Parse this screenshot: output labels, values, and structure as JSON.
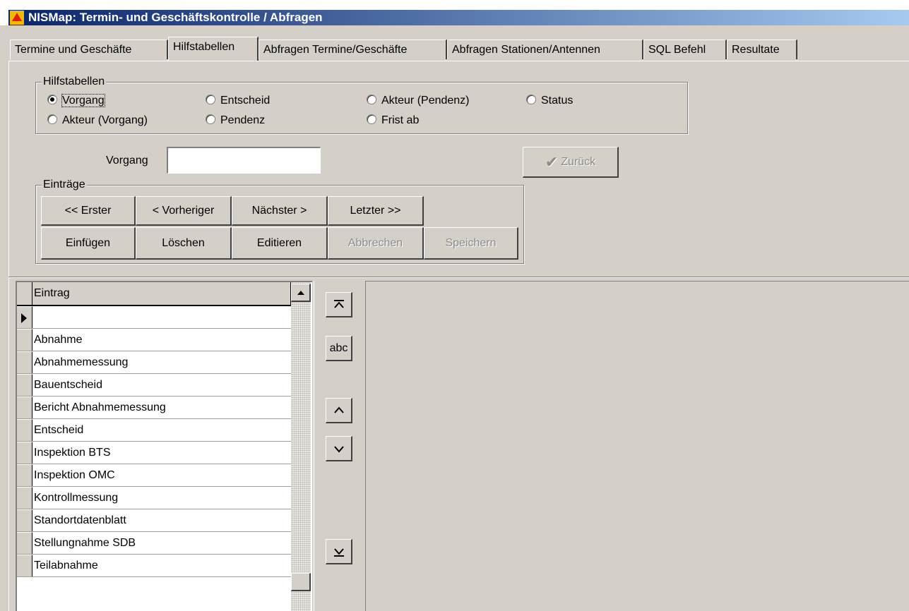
{
  "window": {
    "title": "NISMap: Termin- und Geschäftskontrolle / Abfragen"
  },
  "tabs": [
    {
      "label": "Termine und Geschäfte"
    },
    {
      "label": "Hilfstabellen"
    },
    {
      "label": "Abfragen Termine/Geschäfte"
    },
    {
      "label": "Abfragen Stationen/Antennen"
    },
    {
      "label": "SQL Befehl"
    },
    {
      "label": "Resultate"
    }
  ],
  "active_tab": "Hilfstabellen",
  "hilfstabellen": {
    "legend": "Hilfstabellen",
    "options": [
      {
        "label": "Vorgang",
        "selected": true
      },
      {
        "label": "Entscheid",
        "selected": false
      },
      {
        "label": "Akteur (Pendenz)",
        "selected": false
      },
      {
        "label": "Status",
        "selected": false
      },
      {
        "label": "Akteur (Vorgang)",
        "selected": false
      },
      {
        "label": "Pendenz",
        "selected": false
      },
      {
        "label": "Frist ab",
        "selected": false
      }
    ]
  },
  "field": {
    "label": "Vorgang",
    "value": ""
  },
  "zurueck_button": {
    "label": "Zurück",
    "enabled": false
  },
  "eintraege": {
    "legend": "Einträge",
    "buttons_row1": [
      {
        "label": "<< Erster",
        "enabled": true
      },
      {
        "label": "< Vorheriger",
        "enabled": true
      },
      {
        "label": "Nächster >",
        "enabled": true
      },
      {
        "label": "Letzter >>",
        "enabled": true
      }
    ],
    "buttons_row2": [
      {
        "label": "Einfügen",
        "enabled": true
      },
      {
        "label": "Löschen",
        "enabled": true
      },
      {
        "label": "Editieren",
        "enabled": true
      },
      {
        "label": "Abbrechen",
        "enabled": false
      },
      {
        "label": "Speichern",
        "enabled": false
      }
    ]
  },
  "grid": {
    "column_header": "Eintrag",
    "rows": [
      "",
      "Abnahme",
      "Abnahmemessung",
      "Bauentscheid",
      "Bericht Abnahmemessung",
      "Entscheid",
      "Inspektion BTS",
      "Inspektion OMC",
      "Kontrollmessung",
      "Standortdatenblatt",
      "Stellungnahme SDB",
      "Teilabnahme"
    ]
  },
  "nav_buttons": [
    {
      "icon": "move-to-top-icon"
    },
    {
      "label": "abc",
      "icon": "sort-alphabetical-icon"
    },
    {
      "icon": "move-up-icon"
    },
    {
      "icon": "move-down-icon"
    },
    {
      "icon": "move-to-bottom-icon"
    }
  ]
}
